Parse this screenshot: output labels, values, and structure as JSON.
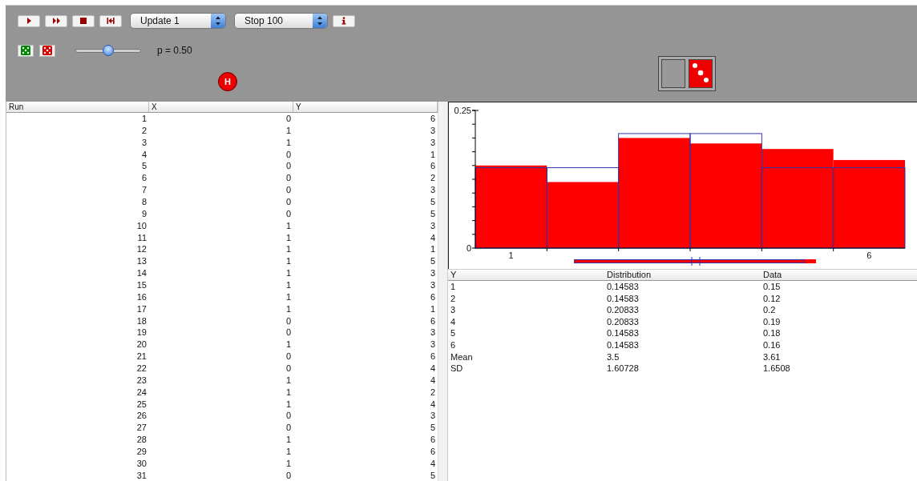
{
  "toolbar": {
    "buttons": [
      {
        "kind": "play"
      },
      {
        "kind": "fast-forward"
      },
      {
        "kind": "stop"
      },
      {
        "kind": "reset"
      }
    ],
    "update_select": {
      "value": "Update 1"
    },
    "stop_select": {
      "value": "Stop 100"
    },
    "info_button": {
      "kind": "info"
    }
  },
  "controls": {
    "dice": [
      {
        "kind": "die",
        "color": "#008800"
      },
      {
        "kind": "die",
        "color": "#dd0000"
      }
    ],
    "probability_slider": {
      "level": 0.5,
      "reading": "p = 0.50"
    },
    "badge": "H"
  },
  "view_toggles": [
    {
      "kind": "blank"
    },
    {
      "kind": "die"
    }
  ],
  "runs_table": {
    "columns": [
      "Run",
      "X",
      "Y"
    ],
    "rows": [
      [
        "1",
        "0",
        "6"
      ],
      [
        "2",
        "1",
        "3"
      ],
      [
        "3",
        "1",
        "3"
      ],
      [
        "4",
        "0",
        "1"
      ],
      [
        "5",
        "0",
        "6"
      ],
      [
        "6",
        "0",
        "2"
      ],
      [
        "7",
        "0",
        "3"
      ],
      [
        "8",
        "0",
        "5"
      ],
      [
        "9",
        "0",
        "5"
      ],
      [
        "10",
        "1",
        "3"
      ],
      [
        "11",
        "1",
        "4"
      ],
      [
        "12",
        "1",
        "1"
      ],
      [
        "13",
        "1",
        "5"
      ],
      [
        "14",
        "1",
        "3"
      ],
      [
        "15",
        "1",
        "3"
      ],
      [
        "16",
        "1",
        "6"
      ],
      [
        "17",
        "1",
        "1"
      ],
      [
        "18",
        "0",
        "6"
      ],
      [
        "19",
        "0",
        "3"
      ],
      [
        "20",
        "1",
        "3"
      ],
      [
        "21",
        "0",
        "6"
      ],
      [
        "22",
        "0",
        "4"
      ],
      [
        "23",
        "1",
        "4"
      ],
      [
        "24",
        "1",
        "2"
      ],
      [
        "25",
        "1",
        "4"
      ],
      [
        "26",
        "0",
        "3"
      ],
      [
        "27",
        "0",
        "5"
      ],
      [
        "28",
        "1",
        "6"
      ],
      [
        "29",
        "1",
        "6"
      ],
      [
        "30",
        "1",
        "4"
      ],
      [
        "31",
        "0",
        "5"
      ]
    ]
  },
  "histogram": {
    "chart_data": {
      "type": "bar",
      "x": [
        1,
        2,
        3,
        4,
        5,
        6
      ],
      "series": [
        {
          "color": "#ff0000",
          "values": [
            0.15,
            0.12,
            0.2,
            0.19,
            0.18,
            0.16
          ]
        },
        {
          "color": "#3333aa",
          "values": [
            0.146,
            0.146,
            0.208,
            0.208,
            0.146,
            0.146
          ]
        }
      ],
      "xlim": [
        0.5,
        6.5
      ],
      "ylim": [
        0,
        0.25
      ],
      "yticks": [
        0,
        0.25
      ],
      "xticks": [
        1,
        6
      ]
    }
  },
  "stats_table": {
    "columns": [
      "Y",
      "Distribution",
      "Data"
    ],
    "rows": [
      [
        "1",
        "0.14583",
        "0.15"
      ],
      [
        "2",
        "0.14583",
        "0.12"
      ],
      [
        "3",
        "0.20833",
        "0.2"
      ],
      [
        "4",
        "0.20833",
        "0.19"
      ],
      [
        "5",
        "0.14583",
        "0.18"
      ],
      [
        "6",
        "0.14583",
        "0.16"
      ],
      [
        "Mean",
        "3.5",
        "3.61"
      ],
      [
        "SD",
        "1.60728",
        "1.6508"
      ]
    ]
  }
}
